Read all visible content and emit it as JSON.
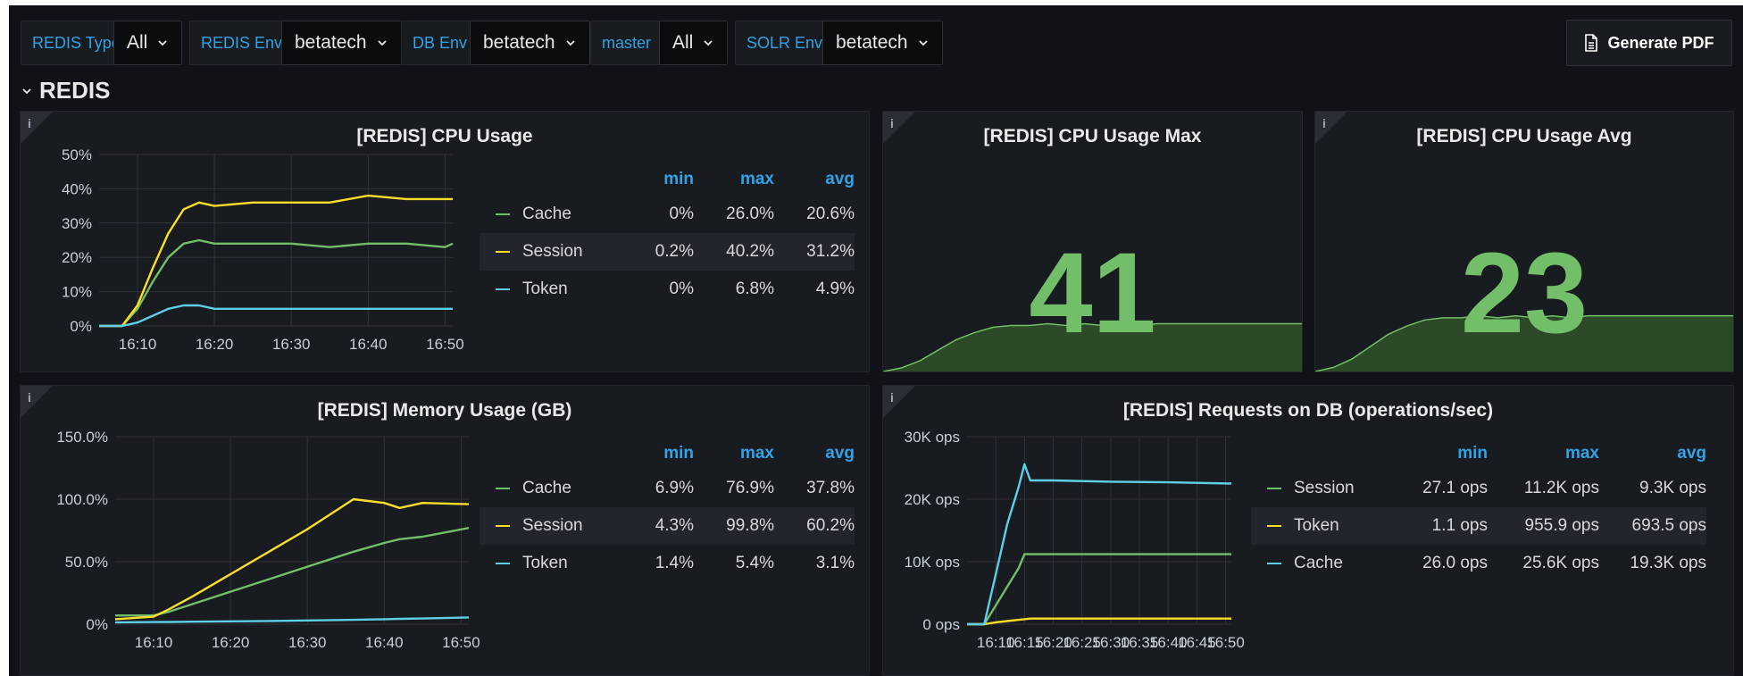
{
  "toolbar": {
    "vars": [
      {
        "label": "REDIS Type",
        "value": "All"
      },
      {
        "label": "REDIS Env.",
        "value": "betatech"
      },
      {
        "label": "DB Env",
        "value": "betatech"
      },
      {
        "label": "master",
        "value": "All"
      },
      {
        "label": "SOLR Env.",
        "value": "betatech"
      }
    ],
    "pdf_label": "Generate PDF"
  },
  "row": {
    "title": "REDIS"
  },
  "panels": {
    "cpu": {
      "title": "[REDIS] CPU Usage",
      "legend_headers": [
        "min",
        "max",
        "avg"
      ],
      "legend": [
        {
          "name": "Cache",
          "min": "0%",
          "max": "26.0%",
          "avg": "20.6%"
        },
        {
          "name": "Session",
          "min": "0.2%",
          "max": "40.2%",
          "avg": "31.2%"
        },
        {
          "name": "Token",
          "min": "0%",
          "max": "6.8%",
          "avg": "4.9%"
        }
      ]
    },
    "cpu_max": {
      "title": "[REDIS] CPU Usage Max",
      "value": "41"
    },
    "cpu_avg": {
      "title": "[REDIS] CPU Usage Avg",
      "value": "23"
    },
    "mem": {
      "title": "[REDIS] Memory Usage (GB)",
      "legend_headers": [
        "min",
        "max",
        "avg"
      ],
      "legend": [
        {
          "name": "Cache",
          "min": "6.9%",
          "max": "76.9%",
          "avg": "37.8%"
        },
        {
          "name": "Session",
          "min": "4.3%",
          "max": "99.8%",
          "avg": "60.2%"
        },
        {
          "name": "Token",
          "min": "1.4%",
          "max": "5.4%",
          "avg": "3.1%"
        }
      ]
    },
    "req": {
      "title": "[REDIS] Requests on DB (operations/sec)",
      "legend_headers": [
        "min",
        "max",
        "avg"
      ],
      "legend": [
        {
          "name": "Session",
          "min": "27.1 ops",
          "max": "11.2K ops",
          "avg": "9.3K ops"
        },
        {
          "name": "Token",
          "min": "1.1 ops",
          "max": "955.9 ops",
          "avg": "693.5 ops"
        },
        {
          "name": "Cache",
          "min": "26.0 ops",
          "max": "25.6K ops",
          "avg": "19.3K ops"
        }
      ]
    }
  },
  "colors": {
    "green": "#73bf69",
    "yellow": "#fade2a",
    "blue": "#5ecfe8",
    "accent": "#33a2e5"
  },
  "chart_data": [
    {
      "type": "line",
      "id": "cpu",
      "x": [
        "16:05",
        "16:08",
        "16:10",
        "16:12",
        "16:14",
        "16:16",
        "16:18",
        "16:20",
        "16:25",
        "16:30",
        "16:35",
        "16:40",
        "16:45",
        "16:50",
        "16:51"
      ],
      "xticks": [
        "16:10",
        "16:20",
        "16:30",
        "16:40",
        "16:50"
      ],
      "ylim": [
        0,
        50
      ],
      "yticks": [
        "0%",
        "10%",
        "20%",
        "30%",
        "40%",
        "50%"
      ],
      "series": [
        {
          "name": "Cache",
          "color": "#73bf69",
          "values": [
            0,
            0,
            5,
            13,
            20,
            24,
            25,
            24,
            24,
            24,
            23,
            24,
            24,
            23,
            24
          ]
        },
        {
          "name": "Session",
          "color": "#fade2a",
          "values": [
            0,
            0,
            6,
            17,
            27,
            34,
            36,
            35,
            36,
            36,
            36,
            38,
            37,
            37,
            37
          ]
        },
        {
          "name": "Token",
          "color": "#5ecfe8",
          "values": [
            0,
            0,
            1,
            3,
            5,
            6,
            6,
            5,
            5,
            5,
            5,
            5,
            5,
            5,
            5
          ]
        }
      ]
    },
    {
      "type": "line",
      "id": "mem",
      "x": [
        "16:05",
        "16:10",
        "16:12",
        "16:15",
        "16:20",
        "16:25",
        "16:30",
        "16:36",
        "16:40",
        "16:42",
        "16:45",
        "16:51"
      ],
      "xticks": [
        "16:10",
        "16:20",
        "16:30",
        "16:40",
        "16:50"
      ],
      "ylim": [
        0,
        150
      ],
      "yticks": [
        "0%",
        "50.0%",
        "100.0%",
        "150.0%"
      ],
      "series": [
        {
          "name": "Cache",
          "color": "#73bf69",
          "values": [
            7,
            7,
            10,
            16,
            26,
            36,
            46,
            58,
            65,
            68,
            70,
            77
          ]
        },
        {
          "name": "Session",
          "color": "#fade2a",
          "values": [
            4,
            6,
            12,
            22,
            40,
            58,
            76,
            100,
            97,
            93,
            97,
            96
          ]
        },
        {
          "name": "Token",
          "color": "#5ecfe8",
          "values": [
            1.5,
            1.7,
            1.8,
            2,
            2.3,
            2.6,
            3,
            3.5,
            4,
            4.3,
            4.6,
            5.4
          ]
        }
      ]
    },
    {
      "type": "line",
      "id": "req",
      "x": [
        "16:05",
        "16:07",
        "16:08",
        "16:10",
        "16:12",
        "16:14",
        "16:15",
        "16:16",
        "16:18",
        "16:20",
        "16:30",
        "16:40",
        "16:51"
      ],
      "xticks": [
        "16:10",
        "16:15",
        "16:20",
        "16:25",
        "16:30",
        "16:35",
        "16:40",
        "16:45",
        "16:50"
      ],
      "ylim": [
        0,
        30000
      ],
      "yticks": [
        "0 ops",
        "10K ops",
        "20K ops",
        "30K ops"
      ],
      "series": [
        {
          "name": "Session",
          "color": "#73bf69",
          "values": [
            0,
            0,
            0,
            3000,
            6000,
            9000,
            11200,
            11200,
            11200,
            11200,
            11200,
            11200,
            11200
          ]
        },
        {
          "name": "Token",
          "color": "#fade2a",
          "values": [
            0,
            0,
            0,
            300,
            500,
            700,
            800,
            900,
            900,
            900,
            900,
            900,
            900
          ]
        },
        {
          "name": "Cache",
          "color": "#5ecfe8",
          "values": [
            0,
            0,
            0,
            8000,
            16000,
            22000,
            25600,
            23000,
            23000,
            23000,
            22800,
            22700,
            22500
          ]
        }
      ]
    },
    {
      "type": "area",
      "id": "cpu_max",
      "values": [
        0,
        2,
        6,
        12,
        18,
        22,
        25,
        26,
        26,
        27,
        26,
        27,
        26,
        27,
        26,
        27,
        27,
        27,
        27,
        27,
        27,
        27,
        27,
        27
      ],
      "ylim": [
        0,
        100
      ]
    },
    {
      "type": "area",
      "id": "cpu_avg",
      "values": [
        0,
        2,
        6,
        12,
        18,
        22,
        25,
        26,
        26,
        27,
        26,
        27,
        26,
        27,
        26,
        27,
        27,
        27,
        27,
        27,
        27,
        27,
        27,
        27
      ],
      "ylim": [
        0,
        100
      ]
    }
  ]
}
